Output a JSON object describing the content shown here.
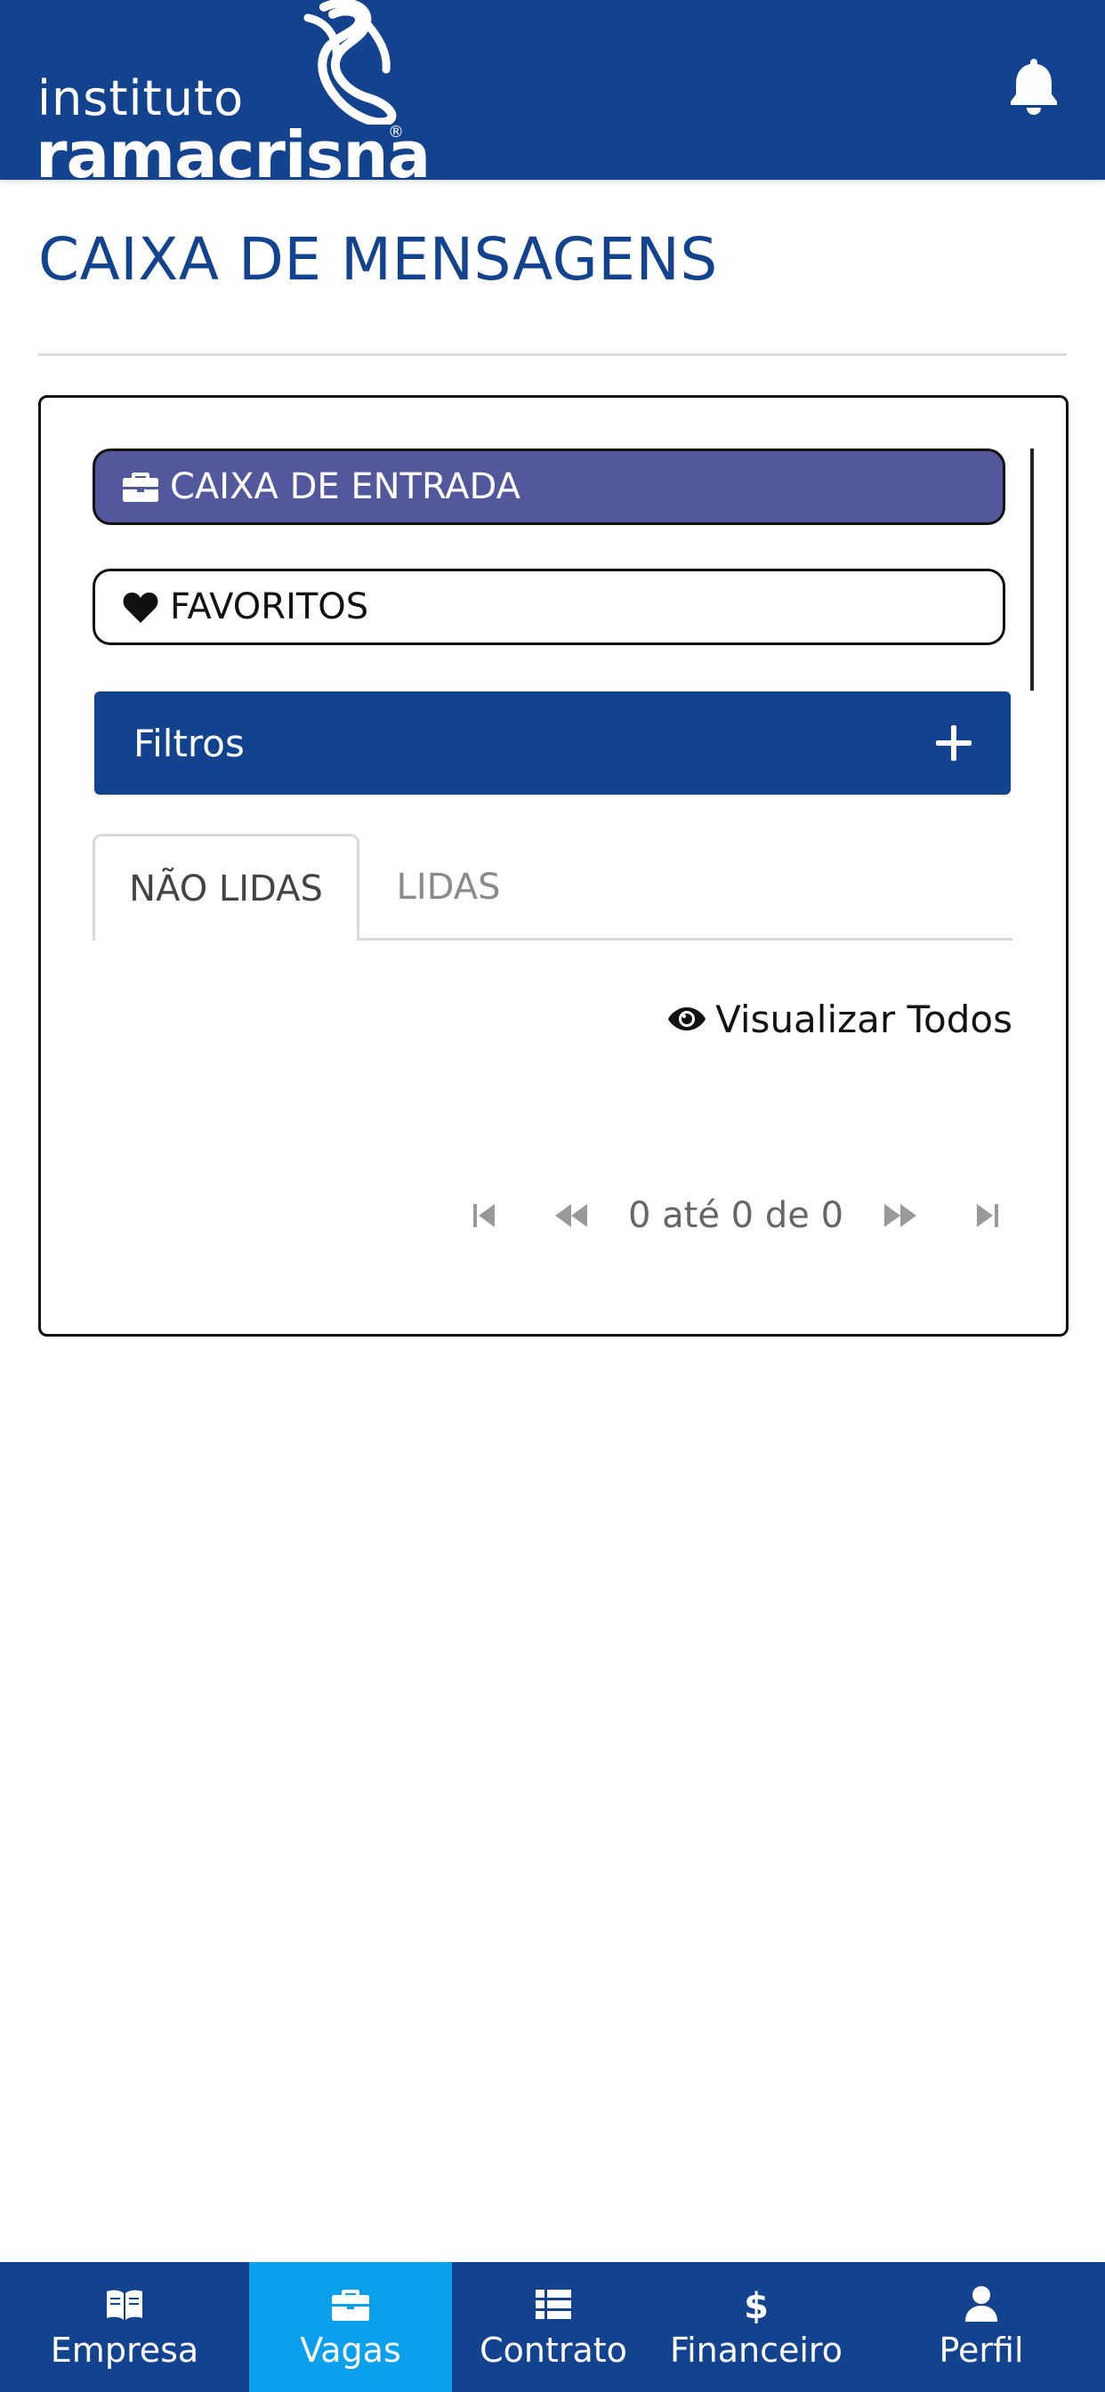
{
  "header": {
    "logo_small": "instituto",
    "logo_big": "ramacrisna",
    "logo_reg": "®",
    "bell_icon": "bell-icon",
    "background": "#13438f"
  },
  "page": {
    "title": "CAIXA DE MENSAGENS"
  },
  "mailbox": {
    "inbox_label": "CAIXA DE ENTRADA",
    "favorites_label": "FAVORITOS",
    "filters_label": "Filtros",
    "tabs": [
      {
        "label": "NÃO LIDAS",
        "active": true
      },
      {
        "label": "LIDAS",
        "active": false
      }
    ],
    "view_all_label": "Visualizar Todos",
    "pagination_text": "0 até 0 de 0"
  },
  "bottom_nav": {
    "items": [
      {
        "label": "Empresa",
        "icon": "book-icon",
        "active": false
      },
      {
        "label": "Vagas",
        "icon": "briefcase-icon",
        "active": true
      },
      {
        "label": "Contrato",
        "icon": "list-icon",
        "active": false
      },
      {
        "label": "Financeiro",
        "icon": "dollar-icon",
        "active": false
      },
      {
        "label": "Perfil",
        "icon": "user-icon",
        "active": false
      }
    ]
  },
  "colors": {
    "brand_blue": "#13438f",
    "inbox_pill": "#52589b",
    "nav_active": "#0aa0ec"
  }
}
